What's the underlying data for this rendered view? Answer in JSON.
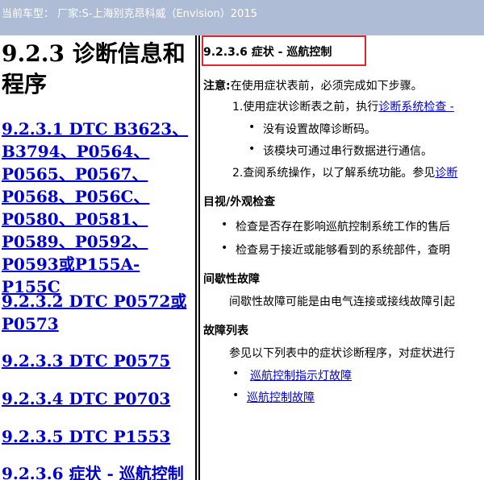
{
  "window": {
    "title": "当前车型：  厂家:S-上海别克昂科威（Envision）2015"
  },
  "toc": {
    "heading": "9.2.3 诊断信息和程序",
    "links": [
      "9.2.3.1 DTC B3623、B3794、P0564、P0565、P0567、P0568、P056C、P0580、P0581、P0589、P0592、P0593或P155A-P155C",
      "9.2.3.2 DTC P0572或P0573",
      "9.2.3.3 DTC P0575",
      "9.2.3.4 DTC P0703",
      "9.2.3.5 DTC P1553",
      "9.2.3.6 症状 - 巡航控制"
    ]
  },
  "content": {
    "section_title": "9.2.3.6 症状 - 巡航控制",
    "note_label": "注意:",
    "note_text": "在使用症状表前，必须完成如下步骤。",
    "step1_prefix": "1.使用症状诊断表之前，执行",
    "step1_link": "诊断系统检查 -",
    "step1_bullets": [
      "没有设置故障诊断码。",
      "该模块可通过串行数据进行通信。"
    ],
    "step2_prefix": "2.查阅系统操作，以了解系统功能。参见",
    "step2_link": "诊断",
    "visual_heading": "目视/外观检查",
    "visual_bullets": [
      "检查是否存在影响巡航控制系统工作的售后",
      "检查易于接近或能够看到的系统部件，查明"
    ],
    "intermittent_heading": "间歇性故障",
    "intermittent_text": "间歇性故障可能是由电气连接或接线故障引起",
    "fault_list_heading": "故障列表",
    "fault_list_text": "参见以下列表中的症状诊断程序，对症状进行",
    "fault_links": [
      "巡航控制指示灯故障",
      "巡航控制故障"
    ]
  }
}
